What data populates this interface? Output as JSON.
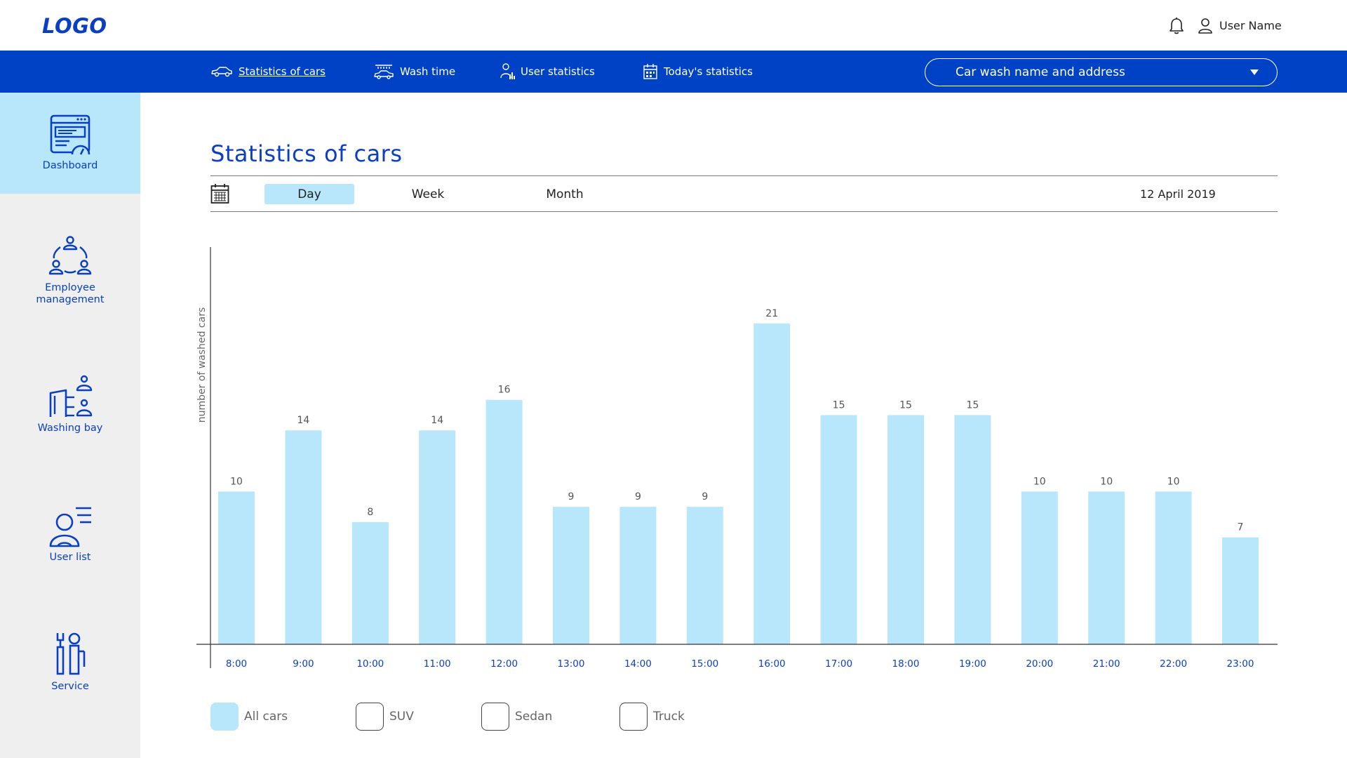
{
  "header": {
    "logo": "LOGO",
    "user_name": "User Name"
  },
  "nav": {
    "items": [
      {
        "label": "Statistics of cars",
        "icon": "car-icon",
        "active": true
      },
      {
        "label": "Wash time",
        "icon": "car-wash-icon",
        "active": false
      },
      {
        "label": "User statistics",
        "icon": "user-chart-icon",
        "active": false
      },
      {
        "label": "Today's statistics",
        "icon": "calendar-chart-icon",
        "active": false
      }
    ],
    "site_select": "Car wash name and address"
  },
  "sidebar": {
    "items": [
      {
        "label": "Dashboard",
        "icon": "dashboard-icon",
        "active": true
      },
      {
        "label": "Employee management",
        "icon": "team-icon",
        "active": false
      },
      {
        "label": "Washing bay",
        "icon": "washing-bay-icon",
        "active": false
      },
      {
        "label": "User list",
        "icon": "user-list-icon",
        "active": false
      },
      {
        "label": "Service",
        "icon": "service-tools-icon",
        "active": false
      }
    ]
  },
  "main": {
    "title": "Statistics of cars",
    "periods": [
      {
        "label": "Day",
        "active": true
      },
      {
        "label": "Week",
        "active": false
      },
      {
        "label": "Month",
        "active": false
      }
    ],
    "date": "12 April 2019"
  },
  "legend": [
    {
      "label": "All cars",
      "checked": true
    },
    {
      "label": "SUV",
      "checked": false
    },
    {
      "label": "Sedan",
      "checked": false
    },
    {
      "label": "Truck",
      "checked": false
    }
  ],
  "colors": {
    "brand_blue": "#0042c6",
    "accent_light": "#b8e6fb",
    "bar": "#b8e6fb"
  },
  "chart_data": {
    "type": "bar",
    "categories": [
      "8:00",
      "9:00",
      "10:00",
      "11:00",
      "12:00",
      "13:00",
      "14:00",
      "15:00",
      "16:00",
      "17:00",
      "18:00",
      "19:00",
      "20:00",
      "21:00",
      "22:00",
      "23:00"
    ],
    "values": [
      10,
      14,
      8,
      14,
      16,
      9,
      9,
      9,
      21,
      15,
      15,
      15,
      10,
      10,
      10,
      7
    ],
    "title": "",
    "xlabel": "",
    "ylabel": "number of washed cars",
    "ylim": [
      0,
      26
    ],
    "grid": false,
    "data_labels": true
  }
}
